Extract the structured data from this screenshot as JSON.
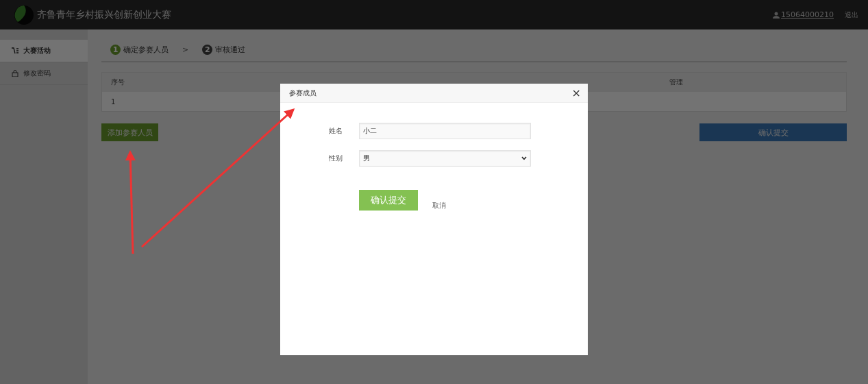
{
  "header": {
    "title": "齐鲁青年乡村振兴创新创业大赛",
    "user": "15064000210",
    "logout": "退出"
  },
  "sidebar": {
    "items": [
      {
        "label": "大赛活动",
        "selected": true
      },
      {
        "label": "修改密码",
        "selected": false
      }
    ]
  },
  "steps": [
    {
      "number": "1",
      "label": "确定参赛人员",
      "selected": true
    },
    {
      "separator": ">",
      "number": "2",
      "label": "审核通过",
      "selected": false
    }
  ],
  "table": {
    "columns": [
      "序号",
      "管理"
    ],
    "rows": [
      [
        "1"
      ]
    ]
  },
  "add_button": "添加参赛人员",
  "confirm_button": "确认提交",
  "dialog": {
    "title": "参赛成员",
    "close": "×",
    "fields": [
      {
        "kind": "text",
        "label": "姓名",
        "value": "小二"
      },
      {
        "kind": "select",
        "label": "性别",
        "value": "男"
      }
    ],
    "submit": "确认提交",
    "cancel": "取消"
  }
}
